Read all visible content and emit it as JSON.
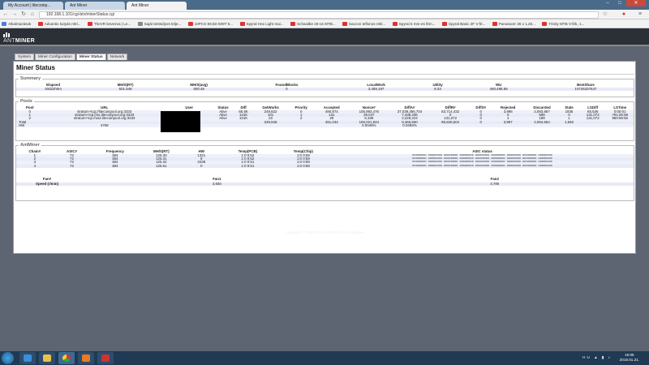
{
  "browser": {
    "tabs": [
      {
        "label": "My Account | litecoinp...",
        "active": false
      },
      {
        "label": "Ant Miner",
        "active": false
      },
      {
        "label": "Ant Miner",
        "active": true
      }
    ],
    "url": "192.168.1.101/cgi-bin/minerStatus.cgi",
    "bookmarks": [
      "Alkalmazások",
      "Advantix kutyás rekl...",
      "TheVR bevezva | Le...",
      "Saját testsúlyos telje...",
      "10PCS 88.5D 509T 6...",
      "Spyral Hex Light mai...",
      "Schwalbe 26-os MTB...",
      "Saccon teflonos rekl...",
      "Spyral 5 mm-es fém...",
      "Spyral Basic 2F V-fé...",
      "Panaracer 26 x 1,25...",
      "Trinity MTB V-fék, 1..."
    ]
  },
  "app": {
    "logo_prefix": "ANT",
    "logo_suffix": "MINER",
    "tabs": [
      "System",
      "Miner Configuration",
      "Miner Status",
      "Network"
    ],
    "active_tab": "Miner Status",
    "title": "Miner Status",
    "footer": "Copyright © 2013-2014, Bitmain Technologies"
  },
  "summary": {
    "legend": "Summary",
    "headers": [
      "Elapsed",
      "MH/S(RT)",
      "MH/S(avg)",
      "FoundBlocks",
      "LocalWork",
      "Utility",
      "WU",
      "BestShare"
    ],
    "values": [
      "40d22h0m",
      "501.548",
      "500.48",
      "0",
      "3,459,197",
      "8.33",
      "460,498.59",
      "10726337647"
    ]
  },
  "pools": {
    "legend": "Pools",
    "headers": [
      "Pool",
      "URL",
      "User",
      "Status",
      "Diff",
      "GetWorks",
      "Priority",
      "Accepted",
      "Nonce#",
      "DiffA#",
      "DiffR#",
      "DiffS#",
      "Rejected",
      "Discarded",
      "Stale",
      "LSDiff",
      "LSTime"
    ],
    "rows": [
      [
        "0",
        "stratum+tcp://litecoinpool.org:3333",
        "",
        "Alive",
        "65.5K",
        "249,822",
        "0",
        "490,874",
        "105,993,476",
        "37,039,366,704",
        "83,714,432",
        "0",
        "3,996",
        "2,093,867",
        "1935",
        "65,536",
        "0:00:01"
      ],
      [
        "1",
        "stratum+tcp://us.litecoinpool.org:3333",
        "",
        "Alive",
        "131K",
        "101",
        "1",
        "131",
        "29,047",
        "7,438,336",
        "0",
        "0",
        "0",
        "598",
        "0",
        "131,072",
        "791:06:58"
      ],
      [
        "2",
        "stratum+tcp://us2.litecoinpool.org:3333",
        "",
        "Alive",
        "131K",
        "23",
        "2",
        "29",
        "9,199",
        "2,228,224",
        "131,072",
        "0",
        "1",
        "189",
        "1",
        "131,072",
        "950:59:56"
      ],
      [
        "Total",
        "",
        "",
        "",
        "",
        "249,946",
        "",
        "491,034",
        "106,021,924",
        "9,466,560",
        "85,845,504",
        "0",
        "3,997",
        "2,094,654",
        "1,936",
        "",
        ""
      ],
      [
        "HW",
        "4769",
        "",
        "",
        "",
        "",
        "",
        "",
        "0.0045%",
        "0.0493%",
        "",
        "",
        "",
        "",
        "",
        "",
        ""
      ]
    ]
  },
  "antminer": {
    "legend": "AntMiner",
    "headers": [
      "Chain#",
      "ASIC#",
      "Frequency",
      "MH/S(RT)",
      "HW",
      "Temp(PCB)",
      "Temp(Chip)",
      "ASIC status"
    ],
    "rows": [
      [
        "1",
        "72",
        "384",
        "125.30",
        "1321",
        "1:0 0:62",
        "1:0 0:59",
        "oooooooo oooooooo oooooooo oooooooo oooooooo oooooooo oooooooo oooooooo oooooooo"
      ],
      [
        "2",
        "72",
        "384",
        "125.31",
        "9",
        "1:0 0:52",
        "1:0 0:59",
        "oooooooo oooooooo oooooooo oooooooo oooooooo oooooooo oooooooo oooooooo oooooooo"
      ],
      [
        "3",
        "72",
        "384",
        "125.32",
        "3439",
        "1:0 0:51",
        "1:0 0:59",
        "oooooooo oooooooo oooooooo oooooooo oooooooo oooooooo oooooooo oooooooo oooooooo"
      ],
      [
        "4",
        "72",
        "384",
        "125.61",
        "0",
        "1:0 0:51",
        "1:0 0:58",
        "oooooooo oooooooo oooooooo oooooooo oooooooo oooooooo oooooooo oooooooo oooooooo"
      ]
    ],
    "fan_headers": [
      "Fan#",
      "Fan1",
      "Fan2"
    ],
    "fan_label": "Speed (r/min)",
    "fan_values": [
      "3,930",
      "3,780"
    ]
  },
  "taskbar": {
    "lang": "HU",
    "time": "16:05",
    "date": "2018.01.21."
  },
  "colors": {
    "header_bg": "#2b2f36",
    "page_bg": "#5e6572",
    "row_alt": "#e8eaf6",
    "taskbar": "#1f3a52"
  }
}
